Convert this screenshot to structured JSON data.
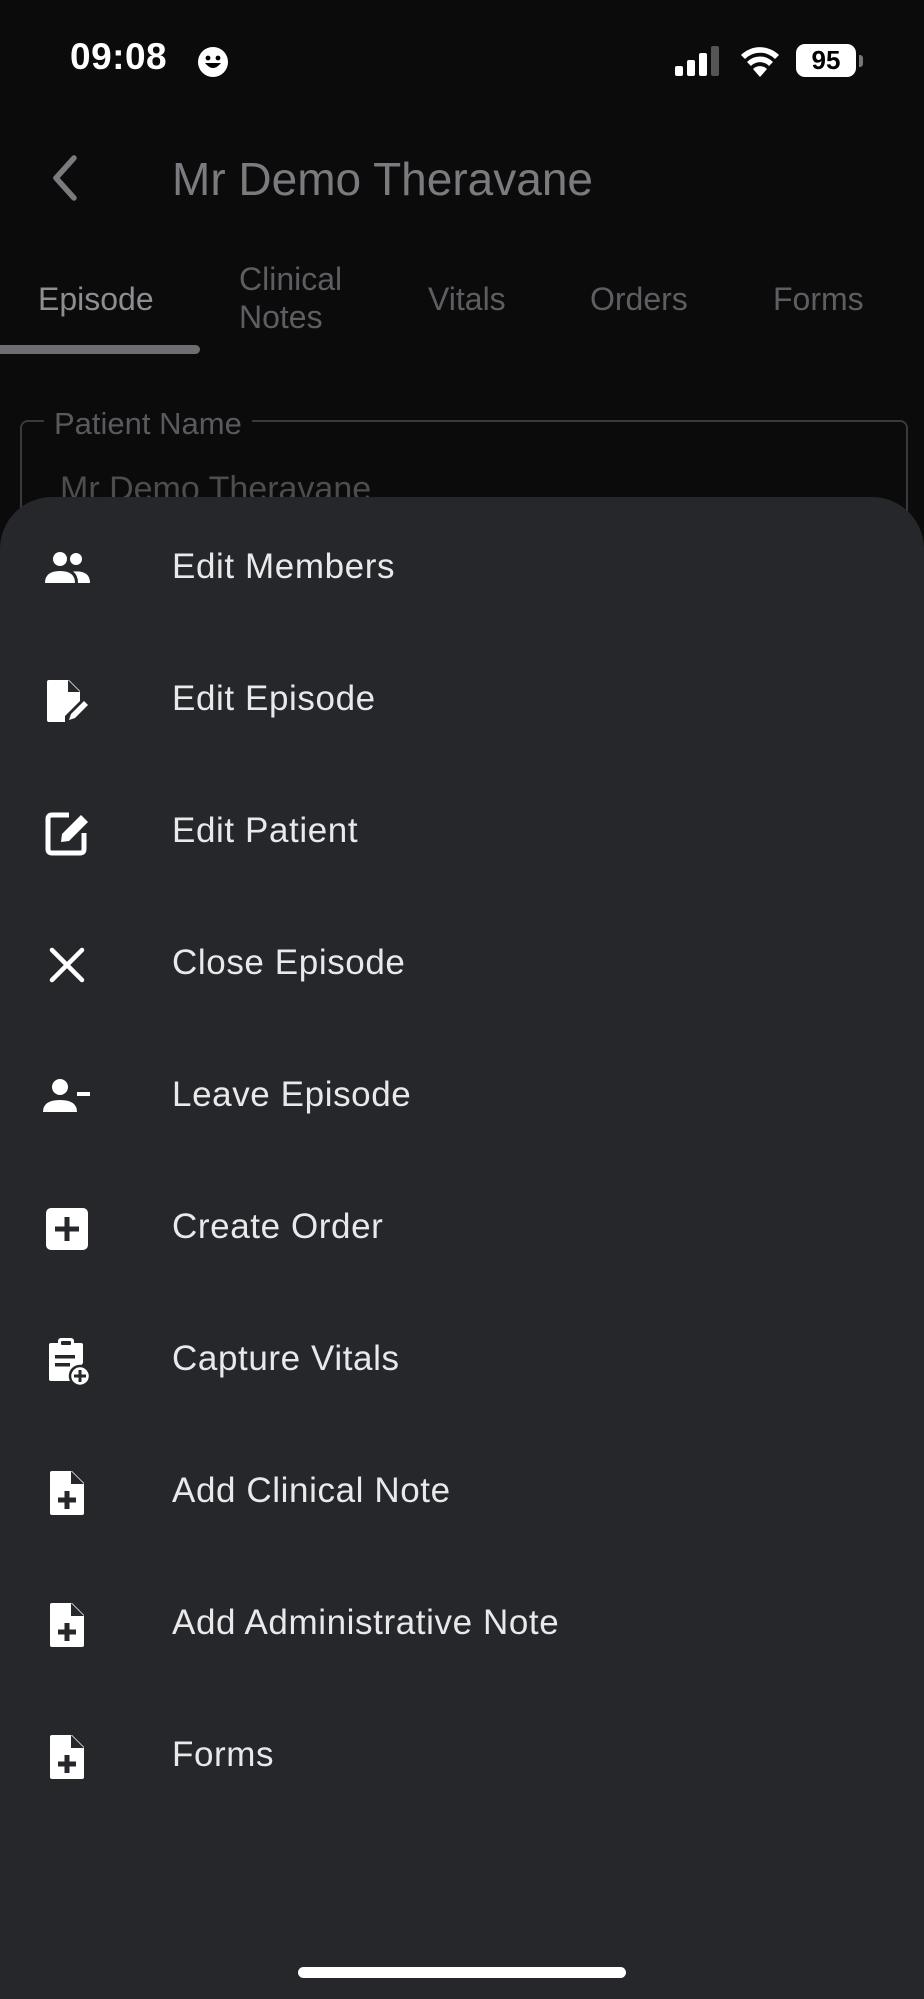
{
  "status_bar": {
    "time": "09:08",
    "battery": "95"
  },
  "app_bar": {
    "title": "Mr Demo Theravane"
  },
  "tabs": [
    {
      "line1": "Episode",
      "line2": ""
    },
    {
      "line1": "Clinical",
      "line2": "Notes"
    },
    {
      "line1": "Vitals",
      "line2": ""
    },
    {
      "line1": "Orders",
      "line2": ""
    },
    {
      "line1": "Forms",
      "line2": ""
    }
  ],
  "active_tab": "Episode",
  "form": {
    "patient_name_label": "Patient Name",
    "patient_name_value": "Mr Demo Theravane"
  },
  "menu": {
    "items": [
      {
        "label": "Edit Members",
        "icon": "group-icon"
      },
      {
        "label": "Edit Episode",
        "icon": "edit-document-icon"
      },
      {
        "label": "Edit Patient",
        "icon": "edit-square-icon"
      },
      {
        "label": "Close Episode",
        "icon": "close-icon"
      },
      {
        "label": "Leave Episode",
        "icon": "person-remove-icon"
      },
      {
        "label": "Create Order",
        "icon": "add-box-icon"
      },
      {
        "label": "Capture Vitals",
        "icon": "clipboard-add-icon"
      },
      {
        "label": "Add Clinical Note",
        "icon": "note-add-icon"
      },
      {
        "label": "Add Administrative Note",
        "icon": "note-add-icon"
      },
      {
        "label": "Forms",
        "icon": "note-add-icon"
      }
    ]
  },
  "colors": {
    "background": "#0b0b0c",
    "sheet": "#26272b",
    "menu_text": "#e9e9ec",
    "dimmed_text": "#7b7b7f"
  }
}
